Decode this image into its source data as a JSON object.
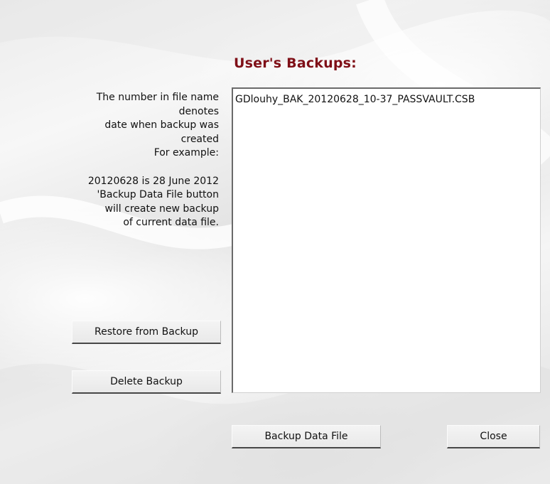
{
  "dialog": {
    "title": "User's Backups:",
    "help_lines": [
      "The number in file name",
      "denotes",
      "date when backup was",
      "created",
      "For example:",
      "",
      "20120628 is 28 June 2012",
      "'Backup Data File button",
      "will create new backup",
      "of current data file."
    ],
    "backups": [
      "GDlouhy_BAK_20120628_10-37_PASSVAULT.CSB"
    ],
    "buttons": {
      "restore": "Restore from Backup",
      "delete": "Delete Backup",
      "backup": "Backup Data File",
      "close": "Close"
    }
  }
}
